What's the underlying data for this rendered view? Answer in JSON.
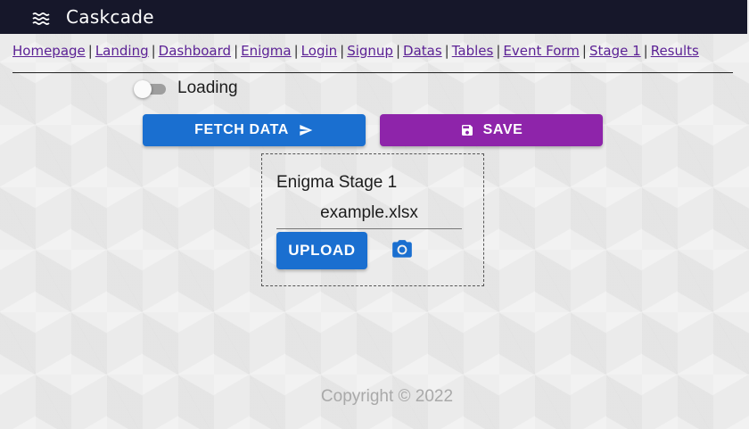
{
  "app": {
    "title": "Caskcade",
    "menu_icon": "waves-menu-icon"
  },
  "nav": {
    "links": [
      "Homepage",
      "Landing",
      "Dashboard",
      "Enigma",
      "Login",
      "Signup",
      "Datas",
      "Tables",
      "Event Form",
      "Stage 1",
      "Results"
    ],
    "separator": "|"
  },
  "toggle": {
    "label": "Loading",
    "checked": false
  },
  "buttons": {
    "fetch_label": "FETCH DATA",
    "fetch_icon": "send-icon",
    "save_label": "SAVE",
    "save_icon": "floppy-disk-icon"
  },
  "card": {
    "title": "Enigma Stage 1",
    "file_name": "example.xlsx",
    "upload_label": "UPLOAD",
    "camera_icon": "camera-icon"
  },
  "footer": {
    "text": "Copyright © 2022"
  },
  "colors": {
    "appbar": "#16172a",
    "primary": "#1a6fd0",
    "accent": "#8e24aa",
    "link": "#5a1f94"
  }
}
